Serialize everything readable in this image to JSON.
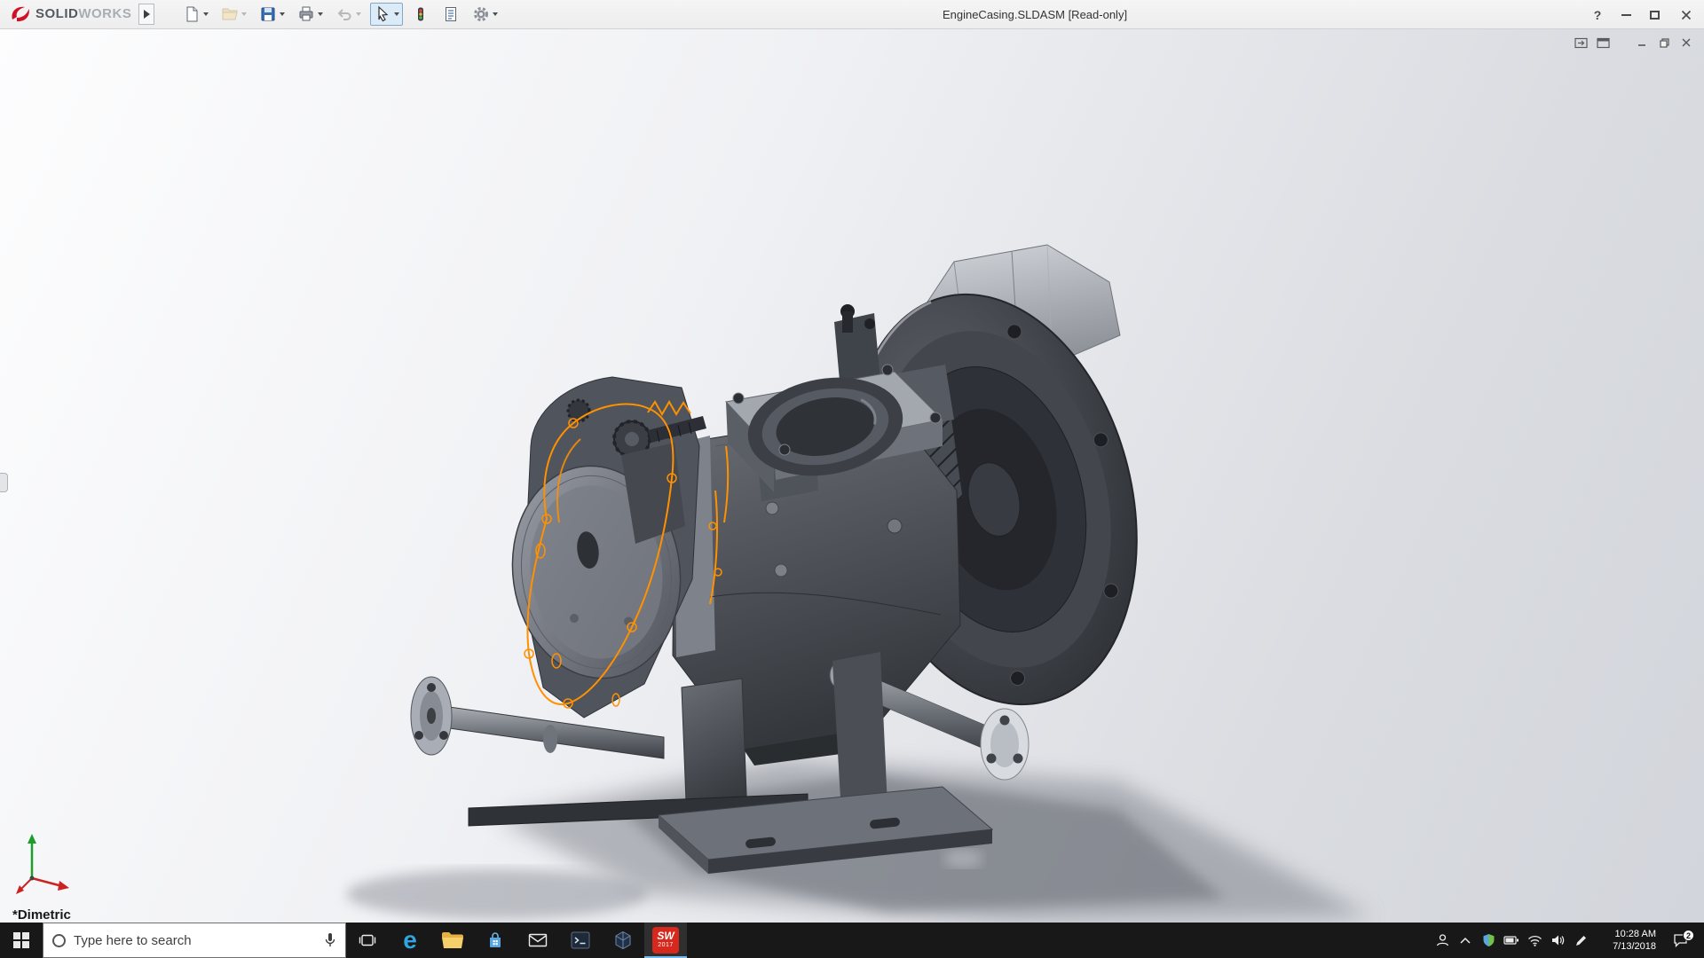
{
  "titlebar": {
    "brand": {
      "prefix": "SOLID",
      "suffix": "WORKS"
    },
    "title": "EngineCasing.SLDASM [Read-only]",
    "help": "?"
  },
  "viewport": {
    "view_orientation": "*Dimetric"
  },
  "model": {
    "selection_color": "#ff9100"
  },
  "taskbar": {
    "search_placeholder": "Type here to search",
    "edge_glyph": "e",
    "solidworks_app": {
      "label": "SW",
      "year": "2017"
    },
    "clock": {
      "time": "10:28 AM",
      "date": "7/13/2018"
    },
    "notification_count": "2"
  }
}
